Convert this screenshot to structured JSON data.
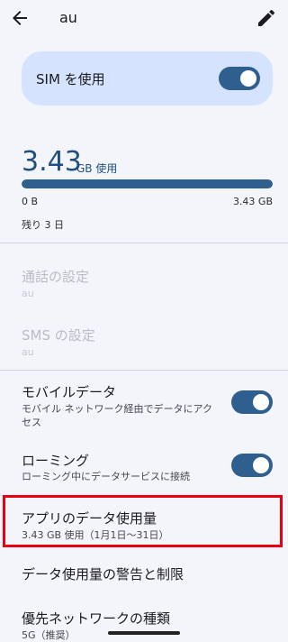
{
  "header": {
    "title": "au"
  },
  "sim": {
    "label": "SIM を使用",
    "enabled": true
  },
  "usage": {
    "amount": "3.43",
    "unit": "GB 使用",
    "fill_fraction": 1.0,
    "range_min": "0 B",
    "range_max": "3.43 GB",
    "remaining": "残り 3 日"
  },
  "call_settings": {
    "title": "通話の設定",
    "subtitle": "au"
  },
  "sms_settings": {
    "title": "SMS の設定",
    "subtitle": "au"
  },
  "mobile_data": {
    "title": "モバイルデータ",
    "subtitle": "モバイル ネットワーク経由でデータにアクセス",
    "enabled": true
  },
  "roaming": {
    "title": "ローミング",
    "subtitle": "ローミング中にデータサービスに接続",
    "enabled": true
  },
  "app_data_usage": {
    "title": "アプリのデータ使用量",
    "subtitle": "3.43 GB 使用（1月1日～31日）"
  },
  "data_warning": {
    "title": "データ使用量の警告と制限"
  },
  "preferred_network": {
    "title": "優先ネットワークの種類",
    "subtitle": "5G（推奨）"
  },
  "colors": {
    "accent": "#2f5f8f",
    "highlight": "#e60012",
    "card": "#d5e3ff"
  }
}
